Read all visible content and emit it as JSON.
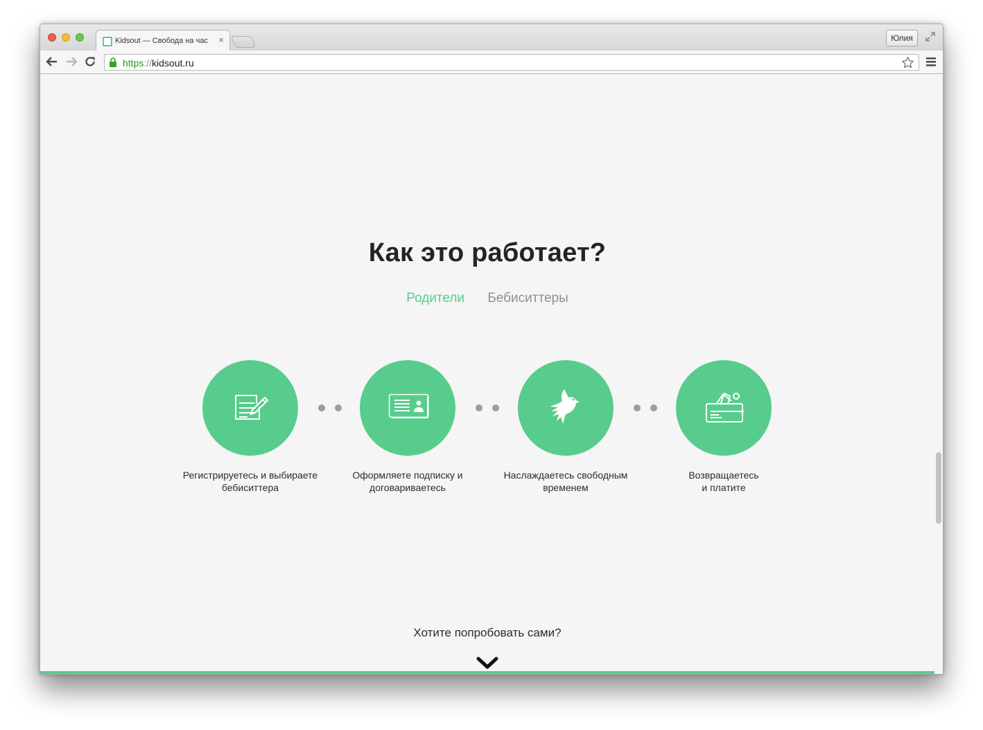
{
  "browser": {
    "tab_title": "Kidsout — Свобода на час",
    "tab_close": "×",
    "profile_name": "Юлия",
    "url_scheme": "https",
    "url_separator": "://",
    "url_host": "kidsout.ru"
  },
  "page": {
    "headline": "Как это работает?",
    "audience_tabs": [
      {
        "label": "Родители",
        "active": true
      },
      {
        "label": "Бебиситтеры",
        "active": false
      }
    ],
    "steps": [
      {
        "icon": "form-pencil-icon",
        "caption_line1": "Регистрируетесь и выбираете",
        "caption_line2": "бебиситтера"
      },
      {
        "icon": "id-card-icon",
        "caption_line1": "Оформляете подписку и",
        "caption_line2": "договариваетесь"
      },
      {
        "icon": "dove-icon",
        "caption_line1": "Наслаждаетесь свободным",
        "caption_line2": "временем"
      },
      {
        "icon": "wallet-icon",
        "caption_line1": "Возвращаетесь",
        "caption_line2": "и платите"
      }
    ],
    "cta": "Хотите попробовать сами?"
  },
  "colors": {
    "accent": "#58cc8c",
    "text_dark": "#242424",
    "text_muted": "#8f8f8f",
    "background": "#f5f5f5"
  }
}
